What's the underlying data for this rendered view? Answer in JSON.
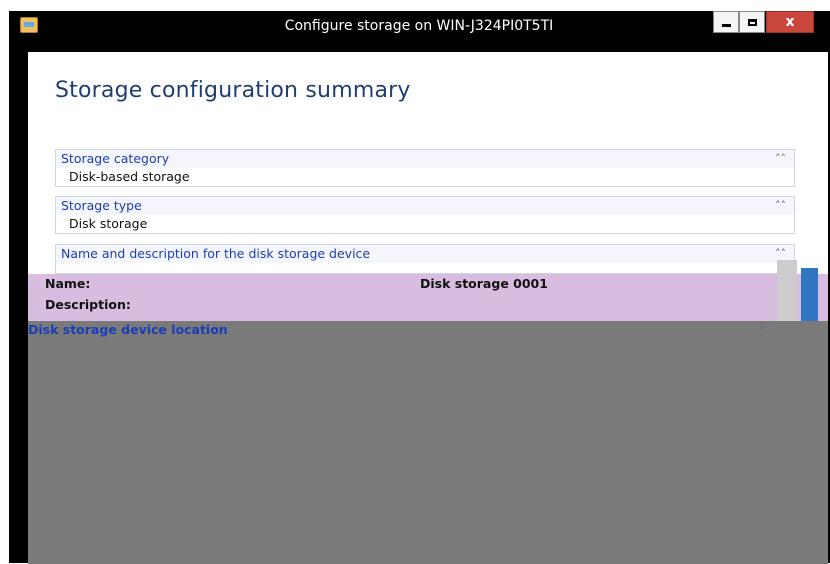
{
  "window": {
    "title": "Configure storage on WIN-J324PI0T5TI",
    "close_label": "x"
  },
  "page": {
    "title": "Storage configuration summary"
  },
  "sections": [
    {
      "heading": "Storage category",
      "value": "Disk-based storage"
    },
    {
      "heading": "Storage type",
      "value": "Disk storage"
    },
    {
      "heading": "Name and description for the disk storage device",
      "value": ""
    }
  ],
  "details": {
    "name_label": "Name:",
    "name_value": "Disk storage 0001",
    "description_label": "Description:",
    "location_heading": "Disk storage device location"
  },
  "icons": {
    "app": "storage-app-icon",
    "collapse": "chevron-double-up-icon"
  }
}
